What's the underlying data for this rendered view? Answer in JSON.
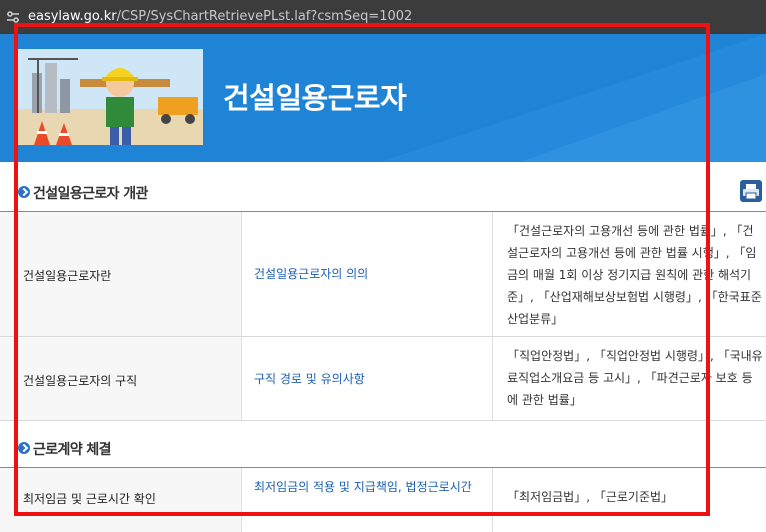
{
  "browser": {
    "url_host": "easylaw.go.kr",
    "url_path": "/CSP/SysChartRetrievePLst.laf?csmSeq=1002",
    "site_info_icon": "tune-icon"
  },
  "banner": {
    "title": "건설일용근로자",
    "image_icon": "construction-worker-illustration"
  },
  "sections": [
    {
      "title": "건설일용근로자 개관",
      "rows": [
        {
          "topic": "건설일용근로자란",
          "link": "건설일용근로자의 의의",
          "laws": "「건설근로자의 고용개선 등에 관한 법률」, 「건설근로자의 고용개선 등에 관한 법률 시행」, 「임금의 매월 1회 이상 정기지급 원칙에 관한 해석기준」, 「산업재해보상보험법 시행령」, 「한국표준산업분류」"
        },
        {
          "topic": "건설일용근로자의 구직",
          "link": "구직 경로 및 유의사항",
          "laws": "「직업안정법」, 「직업안정법 시행령」, 「국내유료직업소개요금 등 고시」, 「파견근로자 보호 등에 관한 법률」"
        }
      ]
    },
    {
      "title": "근로계약 체결",
      "rows": [
        {
          "topic": "최저임금 및 근로시간 확인",
          "link": "최저임금의 적용 및 지급책임, 법정근로시간",
          "laws": "「최저임금법」, 「근로기준법」"
        }
      ]
    }
  ],
  "print_icon": "printer-icon",
  "colors": {
    "banner_bg": "#1f83d6",
    "link": "#1a5fb4",
    "highlight_box": "#ee1111",
    "section_bullet": "#2a72c4"
  }
}
